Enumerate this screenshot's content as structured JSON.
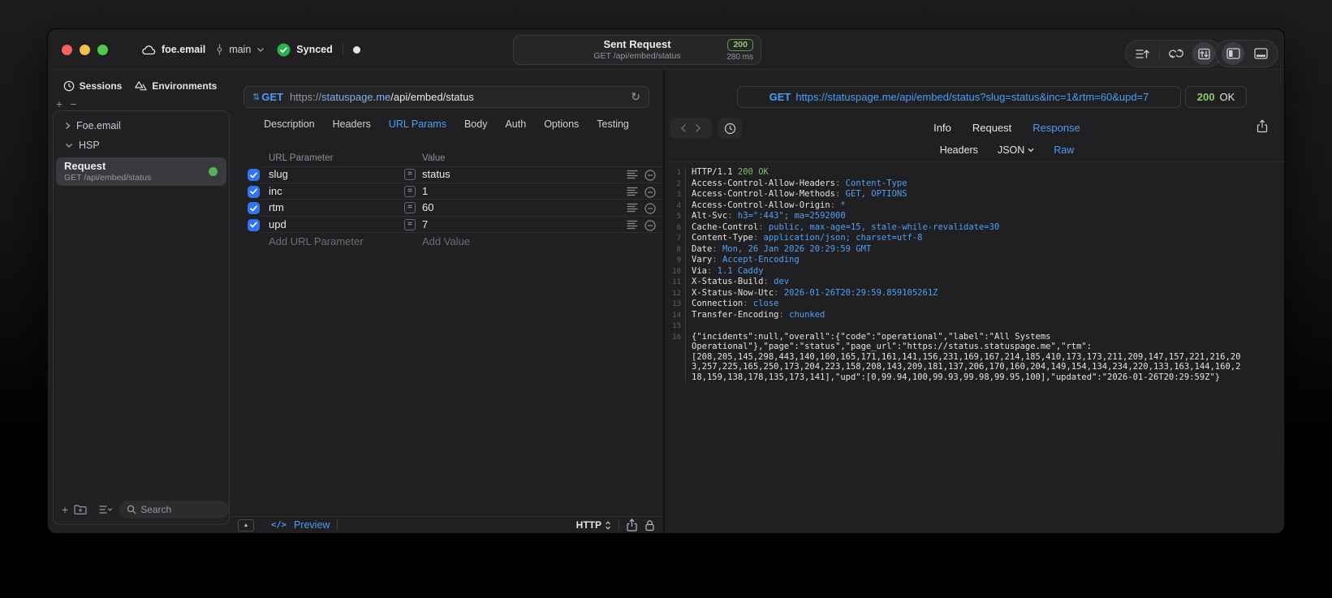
{
  "titlebar": {
    "project": "foe.email",
    "branch": "main",
    "sync": "Synced",
    "title": "Sent Request",
    "subtitle": "GET /api/embed/status",
    "status_code": "200",
    "duration": "280 ms"
  },
  "sidebar": {
    "tabs": [
      {
        "label": "Sessions"
      },
      {
        "label": "Environments"
      }
    ],
    "tree": [
      {
        "label": "Foe.email",
        "expanded": false
      },
      {
        "label": "HSP",
        "expanded": true
      }
    ],
    "request_item": {
      "title": "Request",
      "subtitle": "GET /api/embed/status"
    },
    "search": {
      "placeholder": "Search"
    }
  },
  "request_editor": {
    "method": "GET",
    "url": {
      "scheme": "https://",
      "host": "statuspage.me",
      "path": "/api/embed/status"
    },
    "tabs": [
      "Description",
      "Headers",
      "URL Params",
      "Body",
      "Auth",
      "Options",
      "Testing"
    ],
    "active_tab": "URL Params",
    "params": {
      "columns": {
        "name": "URL Parameter",
        "value": "Value"
      },
      "rows": [
        {
          "name": "slug",
          "value": "status",
          "checked": true
        },
        {
          "name": "inc",
          "value": "1",
          "checked": true
        },
        {
          "name": "rtm",
          "value": "60",
          "checked": true
        },
        {
          "name": "upd",
          "value": "7",
          "checked": true
        }
      ],
      "add_name": "Add URL Parameter",
      "add_value": "Add Value"
    },
    "footer": {
      "code_icon": "</>",
      "preview": "Preview",
      "format": "HTTP"
    }
  },
  "response_viewer": {
    "request_line": {
      "method": "GET",
      "url": "https://statuspage.me/api/embed/status?slug=status&inc=1&rtm=60&upd=7"
    },
    "status_badge": {
      "code": "200",
      "text": "OK"
    },
    "tabs": [
      "Info",
      "Request",
      "Response"
    ],
    "active_tab": "Response",
    "subtabs": [
      "Headers",
      "JSON",
      "Raw"
    ],
    "active_subtab": "Raw",
    "status_line": {
      "protocol": "HTTP/1.1",
      "status": "200 OK"
    },
    "headers": [
      {
        "name": "Access-Control-Allow-Headers",
        "value": "Content-Type"
      },
      {
        "name": "Access-Control-Allow-Methods",
        "value": "GET, OPTIONS"
      },
      {
        "name": "Access-Control-Allow-Origin",
        "value": "*"
      },
      {
        "name": "Alt-Svc",
        "value": "h3=\":443\"; ma=2592000"
      },
      {
        "name": "Cache-Control",
        "value": "public, max-age=15, stale-while-revalidate=30"
      },
      {
        "name": "Content-Type",
        "value": "application/json; charset=utf-8"
      },
      {
        "name": "Date",
        "value": "Mon, 26 Jan 2026 20:29:59 GMT"
      },
      {
        "name": "Vary",
        "value": "Accept-Encoding"
      },
      {
        "name": "Via",
        "value": "1.1 Caddy"
      },
      {
        "name": "X-Status-Build",
        "value": "dev"
      },
      {
        "name": "X-Status-Now-Utc",
        "value": "2026-01-26T20:29:59.859105261Z"
      },
      {
        "name": "Connection",
        "value": "close"
      },
      {
        "name": "Transfer-Encoding",
        "value": "chunked"
      }
    ],
    "body": "{\"incidents\":null,\"overall\":{\"code\":\"operational\",\"label\":\"All Systems Operational\"},\"page\":\"status\",\"page_url\":\"https://status.statuspage.me\",\"rtm\":[208,205,145,298,443,140,160,165,171,161,141,156,231,169,167,214,185,410,173,173,211,209,147,157,221,216,203,257,225,165,250,173,204,223,158,208,143,209,181,137,206,170,160,204,149,154,134,234,220,133,163,144,160,218,159,138,178,135,173,141],\"upd\":[0,99.94,100,99.93,99.98,99.95,100],\"updated\":\"2026-01-26T20:29:59Z\"}"
  },
  "colors": {
    "accent_blue": "#4a9df5",
    "success_green": "#8cc96c",
    "checkbox_blue": "#3074f1"
  }
}
